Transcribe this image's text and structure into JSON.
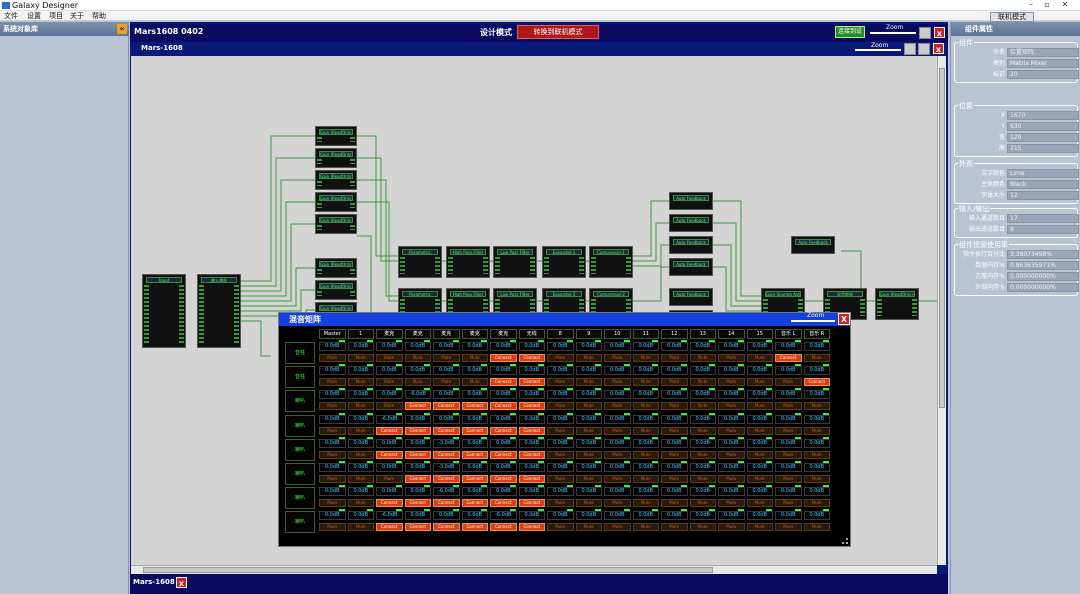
{
  "app": {
    "title": "Galaxy Designer"
  },
  "menu": [
    "文件",
    "设置",
    "项目",
    "关于",
    "帮助"
  ],
  "right_tab": "联机模式",
  "left_panel": {
    "title": "系统对象库"
  },
  "right_panel": {
    "title": "组件属性",
    "groups": [
      {
        "title": "组件",
        "rows": [
          [
            "命名",
            "位置矩阵"
          ],
          [
            "类别",
            "Matrix Mixer"
          ],
          [
            "标识",
            "20"
          ]
        ]
      },
      {
        "title": "位置",
        "rows": [
          [
            "X",
            "1670"
          ],
          [
            "Y",
            "630"
          ],
          [
            "宽",
            "120"
          ],
          [
            "高",
            "215"
          ]
        ]
      },
      {
        "title": "外观",
        "rows": [
          [
            "文字颜色",
            "Lime"
          ],
          [
            "主体颜色",
            "Black"
          ],
          [
            "字体大小",
            "12"
          ]
        ]
      },
      {
        "title": "输入/输出",
        "rows": [
          [
            "输入通道数目",
            "17"
          ],
          [
            "输出通道数目",
            "8"
          ]
        ]
      },
      {
        "title": "组件资源使用率",
        "rows": [
          [
            "指令执行百分比",
            "3.38073498%"
          ],
          [
            "数据内存%",
            "0.863635971%"
          ],
          [
            "方案内存%",
            "0.000000000%"
          ],
          [
            "外部内存%",
            "0.000000000%"
          ]
        ]
      }
    ]
  },
  "doc": {
    "title": "Mars1608 0402",
    "mode_label": "设计模式",
    "switch_button": "转换到联机模式",
    "connect_button": "连接到设",
    "zoom": "Zoom",
    "sub_title": "Mars-1608",
    "bottom_tab": "Mars-1608"
  },
  "blocks": [
    {
      "label": "Input"
    },
    {
      "label": "输入增益"
    },
    {
      "label": "Gain (ReadOnly)-1"
    },
    {
      "label": "Gain (ReadOnly)-2"
    },
    {
      "label": "Gain (ReadOnly)-3"
    },
    {
      "label": "Gain (ReadOnly)-4"
    },
    {
      "label": "Gain (ReadOnly)-5"
    },
    {
      "label": "Gain (ReadOnly)-7"
    },
    {
      "label": "Gain (ReadOnly)-8"
    },
    {
      "label": "Gain (ReadOnly)-9"
    },
    {
      "label": "Parametric"
    },
    {
      "label": "High Pass Filter"
    },
    {
      "label": "Low Pass Filter"
    },
    {
      "label": "Expander-1"
    },
    {
      "label": "Compressor-1"
    },
    {
      "label": "Parametric"
    },
    {
      "label": "High Pass Filter"
    },
    {
      "label": "Low Pass Filter"
    },
    {
      "label": "Expander-2"
    },
    {
      "label": "Compressor-2"
    },
    {
      "label": "Auto Feedback"
    },
    {
      "label": "Auto Feedback"
    },
    {
      "label": "Auto Feedback"
    },
    {
      "label": "Auto Feedback"
    },
    {
      "label": "Auto Feedback"
    },
    {
      "label": "Auto Feedback"
    },
    {
      "label": "Gain Sharing Auto"
    },
    {
      "label": "混音矩阵"
    },
    {
      "label": "Gain (ReadOnly)-17"
    }
  ],
  "matrix": {
    "title": "混音矩阵",
    "zoom": "Zoom",
    "columns": [
      "Master",
      "1",
      "麦克",
      "麦克",
      "麦克",
      "麦克",
      "麦克",
      "无线",
      "8",
      "9",
      "10",
      "11",
      "12",
      "13",
      "14",
      "15",
      "音乐 L",
      "音乐 R"
    ],
    "rows": [
      {
        "label": "音柱",
        "vals": [
          "0.0dB",
          "0.0dB",
          "0.0dB",
          "0.0dB",
          "0.0dB",
          "0.0dB",
          "0.0dB",
          "0.0dB",
          "0.0dB",
          "0.0dB",
          "0.0dB",
          "0.0dB",
          "0.0dB",
          "0.0dB",
          "0.0dB",
          "0.0dB",
          "0.0dB",
          "0.0dB"
        ],
        "on": [
          6,
          7,
          16
        ]
      },
      {
        "label": "音柱",
        "vals": [
          "0.0dB",
          "0.0dB",
          "0.0dB",
          "0.0dB",
          "0.0dB",
          "0.0dB",
          "0.0dB",
          "0.0dB",
          "0.0dB",
          "0.0dB",
          "0.0dB",
          "0.0dB",
          "0.0dB",
          "0.0dB",
          "0.0dB",
          "0.0dB",
          "0.0dB",
          "0.0dB"
        ],
        "on": [
          6,
          7,
          17
        ]
      },
      {
        "label": "喇叭",
        "vals": [
          "0.0dB",
          "0.0dB",
          "0.0dB",
          "-6.0dB",
          "0.0dB",
          "0.0dB",
          "0.0dB",
          "0.0dB",
          "0.0dB",
          "0.0dB",
          "0.0dB",
          "0.0dB",
          "0.0dB",
          "0.0dB",
          "0.0dB",
          "0.0dB",
          "0.0dB",
          "0.0dB"
        ],
        "on": [
          3,
          4,
          5,
          6,
          7
        ]
      },
      {
        "label": "喇叭",
        "vals": [
          "0.0dB",
          "0.0dB",
          "-6.0dB",
          "0.0dB",
          "0.0dB",
          "0.0dB",
          "0.0dB",
          "0.0dB",
          "0.0dB",
          "0.0dB",
          "0.0dB",
          "0.0dB",
          "0.0dB",
          "0.0dB",
          "0.0dB",
          "0.0dB",
          "0.0dB",
          "0.0dB"
        ],
        "on": [
          2,
          3,
          4,
          5,
          6,
          7
        ]
      },
      {
        "label": "喇叭",
        "vals": [
          "0.0dB",
          "0.0dB",
          "0.0dB",
          "0.0dB",
          "-3.0dB",
          "0.0dB",
          "0.0dB",
          "0.0dB",
          "0.0dB",
          "0.0dB",
          "0.0dB",
          "0.0dB",
          "0.0dB",
          "0.0dB",
          "0.0dB",
          "0.0dB",
          "0.0dB",
          "0.0dB"
        ],
        "on": [
          2,
          3,
          4,
          5,
          6,
          7
        ]
      },
      {
        "label": "喇叭",
        "vals": [
          "0.0dB",
          "0.0dB",
          "0.0dB",
          "0.0dB",
          "-3.0dB",
          "0.0dB",
          "0.0dB",
          "0.0dB",
          "0.0dB",
          "0.0dB",
          "0.0dB",
          "0.0dB",
          "0.0dB",
          "0.0dB",
          "0.0dB",
          "0.0dB",
          "0.0dB",
          "0.0dB"
        ],
        "on": [
          3,
          4,
          5,
          6,
          7
        ]
      },
      {
        "label": "喇叭",
        "vals": [
          "0.0dB",
          "0.0dB",
          "0.0dB",
          "0.0dB",
          "-6.0dB",
          "0.0dB",
          "0.0dB",
          "0.0dB",
          "0.0dB",
          "0.0dB",
          "0.0dB",
          "0.0dB",
          "0.0dB",
          "0.0dB",
          "0.0dB",
          "0.0dB",
          "0.0dB",
          "0.0dB"
        ],
        "on": [
          2,
          3,
          4,
          5,
          6,
          7
        ]
      },
      {
        "label": "喇叭",
        "vals": [
          "0.0dB",
          "0.0dB",
          "-6.0dB",
          "0.0dB",
          "0.0dB",
          "0.0dB",
          "-6.0dB",
          "0.0dB",
          "0.0dB",
          "0.0dB",
          "0.0dB",
          "0.0dB",
          "0.0dB",
          "0.0dB",
          "0.0dB",
          "0.0dB",
          "0.0dB",
          "0.0dB"
        ],
        "on": [
          2,
          3,
          4,
          5,
          6,
          7
        ]
      }
    ],
    "btn_on": "Connect",
    "btn_off": "Mute"
  }
}
